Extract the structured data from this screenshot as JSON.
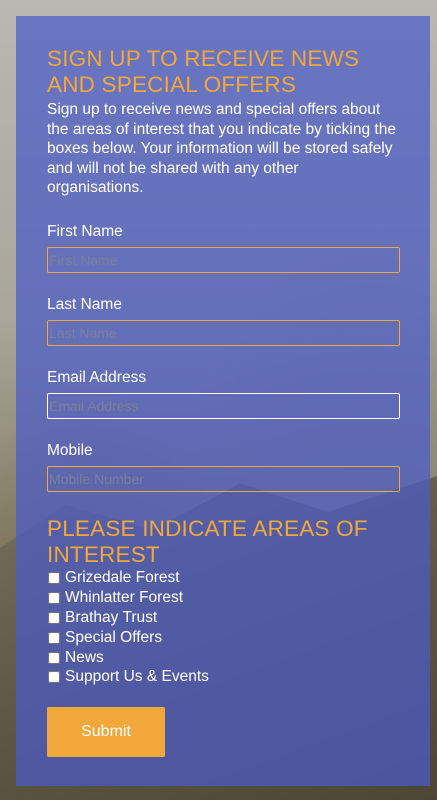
{
  "signup": {
    "title": "SIGN UP TO RECEIVE NEWS AND SPECIAL OFFERS",
    "intro": "Sign up to receive news and special offers about the areas of interest that you indicate by ticking the boxes below. Your information will be stored safely and will not be shared with any other organisations.",
    "fields": [
      {
        "label": "First Name",
        "placeholder": "First Name",
        "value": ""
      },
      {
        "label": "Last Name",
        "placeholder": "Last Name",
        "value": ""
      },
      {
        "label": "Email Address",
        "placeholder": "Email Address",
        "value": ""
      },
      {
        "label": "Mobile",
        "placeholder": "Mobile Number",
        "value": ""
      }
    ],
    "interests_title": "PLEASE INDICATE AREAS OF INTEREST",
    "interests": [
      {
        "label": "Grizedale Forest",
        "checked": false
      },
      {
        "label": "Whinlatter Forest",
        "checked": false
      },
      {
        "label": "Brathay Trust",
        "checked": false
      },
      {
        "label": "Special Offers",
        "checked": false
      },
      {
        "label": "News",
        "checked": false
      },
      {
        "label": "Support Us & Events",
        "checked": false
      }
    ],
    "submit_label": "Submit"
  },
  "colors": {
    "panel": "#4b5cc8",
    "accent": "#f2a73b",
    "text": "#ffffff"
  }
}
